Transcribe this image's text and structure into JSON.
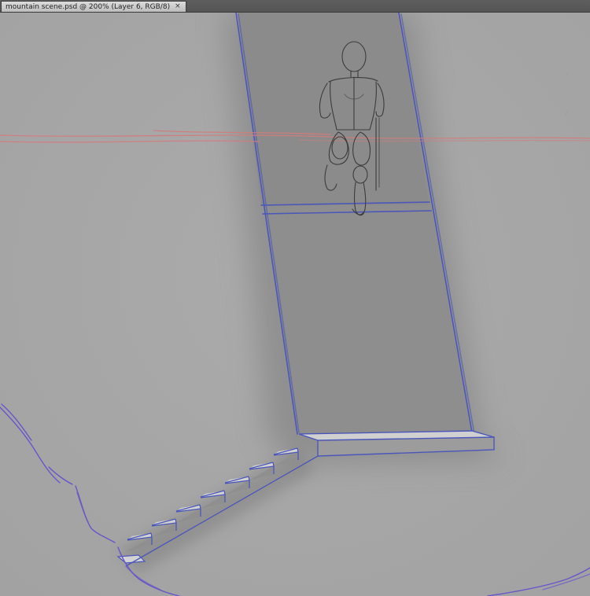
{
  "document_tab": {
    "title": "mountain scene.psd @ 200% (Layer 6, RGB/8)",
    "close_glyph": "×",
    "close_icon": "close-icon"
  },
  "colors": {
    "canvas_bg": "#a7a7a7",
    "wall": "#8d8d8d",
    "outline_blue": "#4b57b8",
    "outline_purple": "#6a55c8",
    "horizon_red": "#d37c7c",
    "sketch_pencil": "#3c3c3c",
    "step_highlight": "#d2d2d2"
  }
}
